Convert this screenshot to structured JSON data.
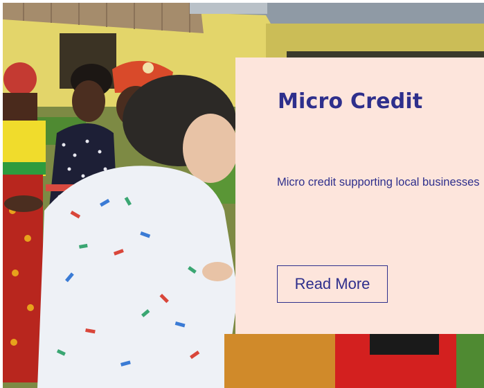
{
  "card": {
    "title": "Micro Credit",
    "description": "Micro credit supporting local businesses",
    "button_label": "Read More"
  },
  "colors": {
    "card_background": "#fde5dc",
    "accent": "#2e2f8c"
  }
}
